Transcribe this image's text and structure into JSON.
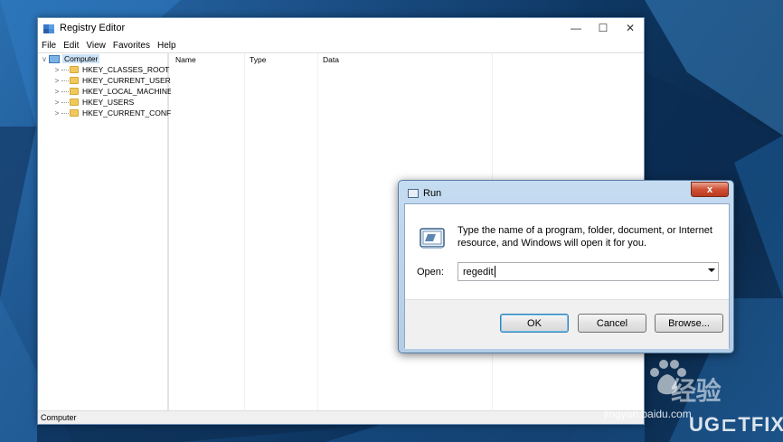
{
  "registry_editor": {
    "title": "Registry Editor",
    "window_controls": {
      "minimize": "—",
      "maximize": "☐",
      "close": "✕"
    },
    "menu": [
      "File",
      "Edit",
      "View",
      "Favorites",
      "Help"
    ],
    "tree": {
      "root": "Computer",
      "root_chevron": "v",
      "children": [
        {
          "label": "HKEY_CLASSES_ROOT",
          "chevron": ">"
        },
        {
          "label": "HKEY_CURRENT_USER",
          "chevron": ">"
        },
        {
          "label": "HKEY_LOCAL_MACHINE",
          "chevron": ">"
        },
        {
          "label": "HKEY_USERS",
          "chevron": ">"
        },
        {
          "label": "HKEY_CURRENT_CONFIG",
          "chevron": ">"
        }
      ]
    },
    "columns": [
      "Name",
      "Type",
      "Data"
    ],
    "status": "Computer"
  },
  "run_dialog": {
    "title": "Run",
    "close_glyph": "x",
    "description": "Type the name of a program, folder, document, or Internet resource, and Windows will open it for you.",
    "open_label": "Open:",
    "open_value": "regedit",
    "buttons": {
      "ok": "OK",
      "cancel": "Cancel",
      "browse": "Browse..."
    }
  },
  "watermark": {
    "baidu": "Bai",
    "baidu_suffix": "经验",
    "jingyan": "jingyan.baidu.com",
    "ugetfix": "UG⊏TFIX"
  },
  "colors": {
    "desktop_dark": "#0e3763",
    "desktop_light": "#2a6fb0",
    "selection": "#cde3f7",
    "run_frame": "#b3cde7",
    "close_red": "#cf5035"
  }
}
